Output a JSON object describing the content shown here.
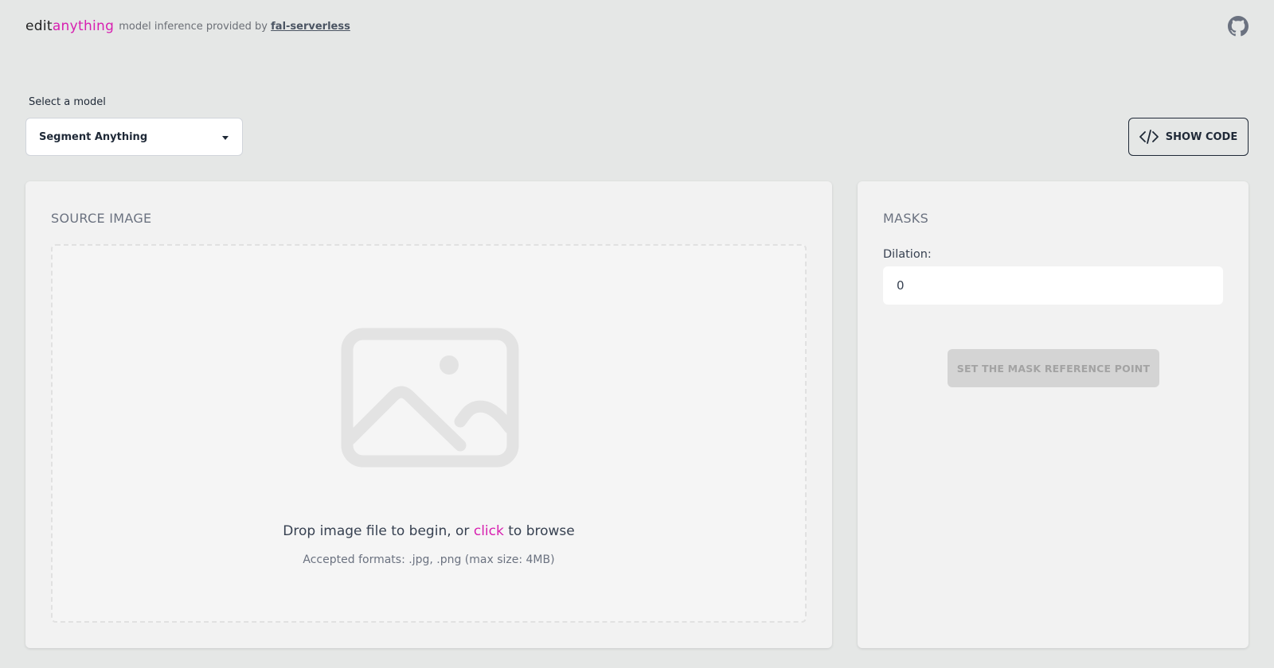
{
  "header": {
    "brand_prefix": "edit",
    "brand_accent": "anything",
    "tagline": "model inference provided by",
    "provider_link": "fal-serverless",
    "github_icon": "github-icon"
  },
  "model_select": {
    "label": "Select a model",
    "value": "Segment Anything",
    "caret_icon": "caret-down-icon"
  },
  "show_code": {
    "label": "SHOW CODE",
    "icon": "code-icon"
  },
  "source": {
    "title": "SOURCE IMAGE",
    "icon": "image-placeholder-icon",
    "drop_text_before": "Drop image file to begin, or",
    "drop_link": "click",
    "drop_text_after": "to browse",
    "accepted": "Accepted formats: .jpg, .png (max size: 4MB)"
  },
  "masks": {
    "title": "MASKS",
    "dilation_label": "Dilation:",
    "dilation_value": "0",
    "button_label": "SET THE MASK REFERENCE POINT"
  },
  "colors": {
    "accent": "#d71fb0",
    "background": "#e5e7e6",
    "card": "#f2f2f2"
  }
}
